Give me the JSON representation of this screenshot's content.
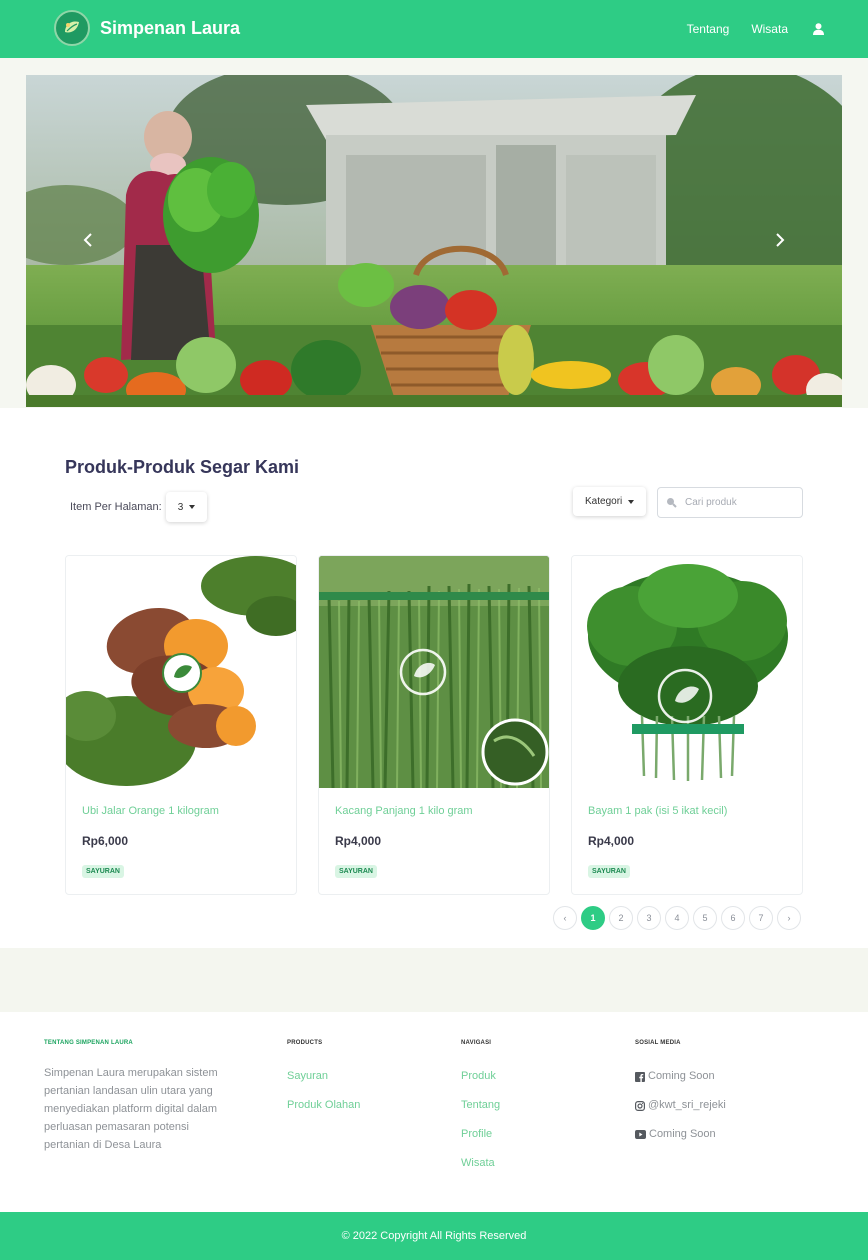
{
  "colors": {
    "brand": "#2ecc85",
    "link": "#6fcf97",
    "badge_bg": "#d9f5e4",
    "title": "#36365a"
  },
  "navbar": {
    "brand_name": "Simpenan Laura",
    "links": [
      "Tentang",
      "Wisata"
    ],
    "user_icon": "user-icon"
  },
  "hero": {
    "prev_icon": "chevron-left-icon",
    "next_icon": "chevron-right-icon"
  },
  "products": {
    "title": "Produk-Produk Segar Kami",
    "per_page_label": "Item Per Halaman:",
    "per_page_value": "3",
    "category_label": "Kategori",
    "search_placeholder": "Cari produk",
    "items": [
      {
        "name": "Ubi Jalar Orange 1 kilogram",
        "price": "Rp6,000",
        "category": "SAYURAN"
      },
      {
        "name": "Kacang Panjang 1 kilo gram",
        "price": "Rp4,000",
        "category": "SAYURAN"
      },
      {
        "name": "Bayam 1 pak (isi 5 ikat kecil)",
        "price": "Rp4,000",
        "category": "SAYURAN"
      }
    ]
  },
  "pagination": {
    "prev": "‹",
    "next": "›",
    "pages": [
      "1",
      "2",
      "3",
      "4",
      "5",
      "6",
      "7"
    ],
    "current": "1"
  },
  "footer": {
    "about_title": "TENTANG SIMPENAN LAURA",
    "about_text": "Simpenan Laura merupakan sistem pertanian landasan ulin utara yang menyediakan platform digital dalam perluasan pemasaran potensi pertanian di Desa Laura",
    "products_title": "PRODUCTS",
    "products_links": [
      "Sayuran",
      "Produk Olahan"
    ],
    "nav_title": "NAVIGASI",
    "nav_links": [
      "Produk",
      "Tentang",
      "Profile",
      "Wisata"
    ],
    "social_title": "SOSIAL MEDIA",
    "social_links": [
      {
        "icon": "facebook-icon",
        "label": "Coming Soon"
      },
      {
        "icon": "instagram-icon",
        "label": "@kwt_sri_rejeki"
      },
      {
        "icon": "youtube-icon",
        "label": "Coming Soon"
      }
    ],
    "copyright": "© 2022 Copyright All Rights Reserved"
  }
}
